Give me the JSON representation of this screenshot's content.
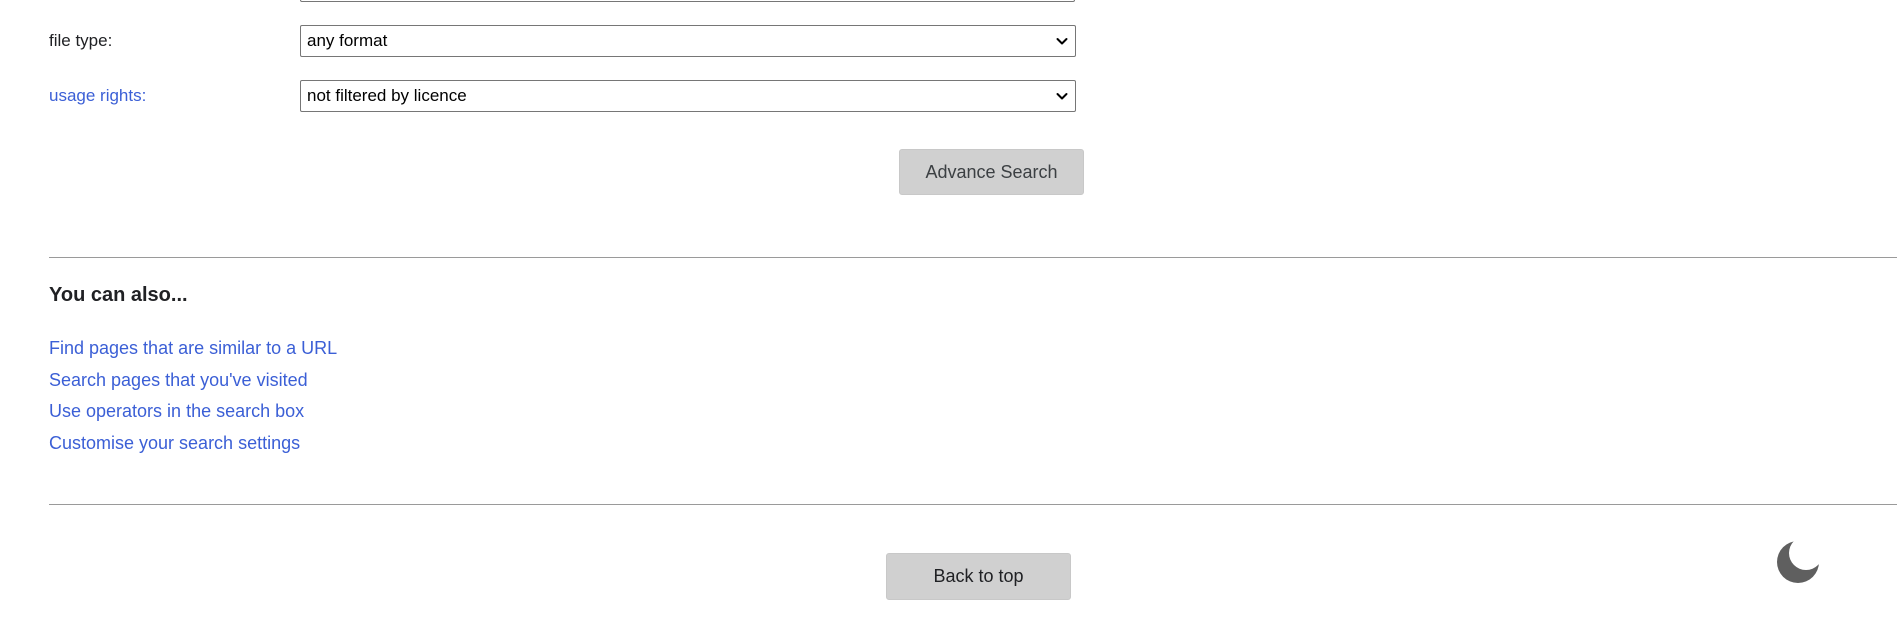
{
  "form": {
    "file_type": {
      "label": "file type:",
      "selected": "any format"
    },
    "usage_rights": {
      "label": "usage rights:",
      "selected": "not filtered by licence"
    },
    "submit_label": "Advance Search"
  },
  "also": {
    "heading": "You can also...",
    "links": [
      "Find pages that are similar to a URL",
      "Search pages that you've visited",
      "Use operators in the search box",
      "Customise your search settings"
    ]
  },
  "footer": {
    "back_to_top_label": "Back to top",
    "theme_toggle_icon": "moon-icon"
  },
  "colors": {
    "link": "#3b5fd6",
    "button_bg": "#d0d0d0",
    "divider": "#9a9a9a"
  }
}
